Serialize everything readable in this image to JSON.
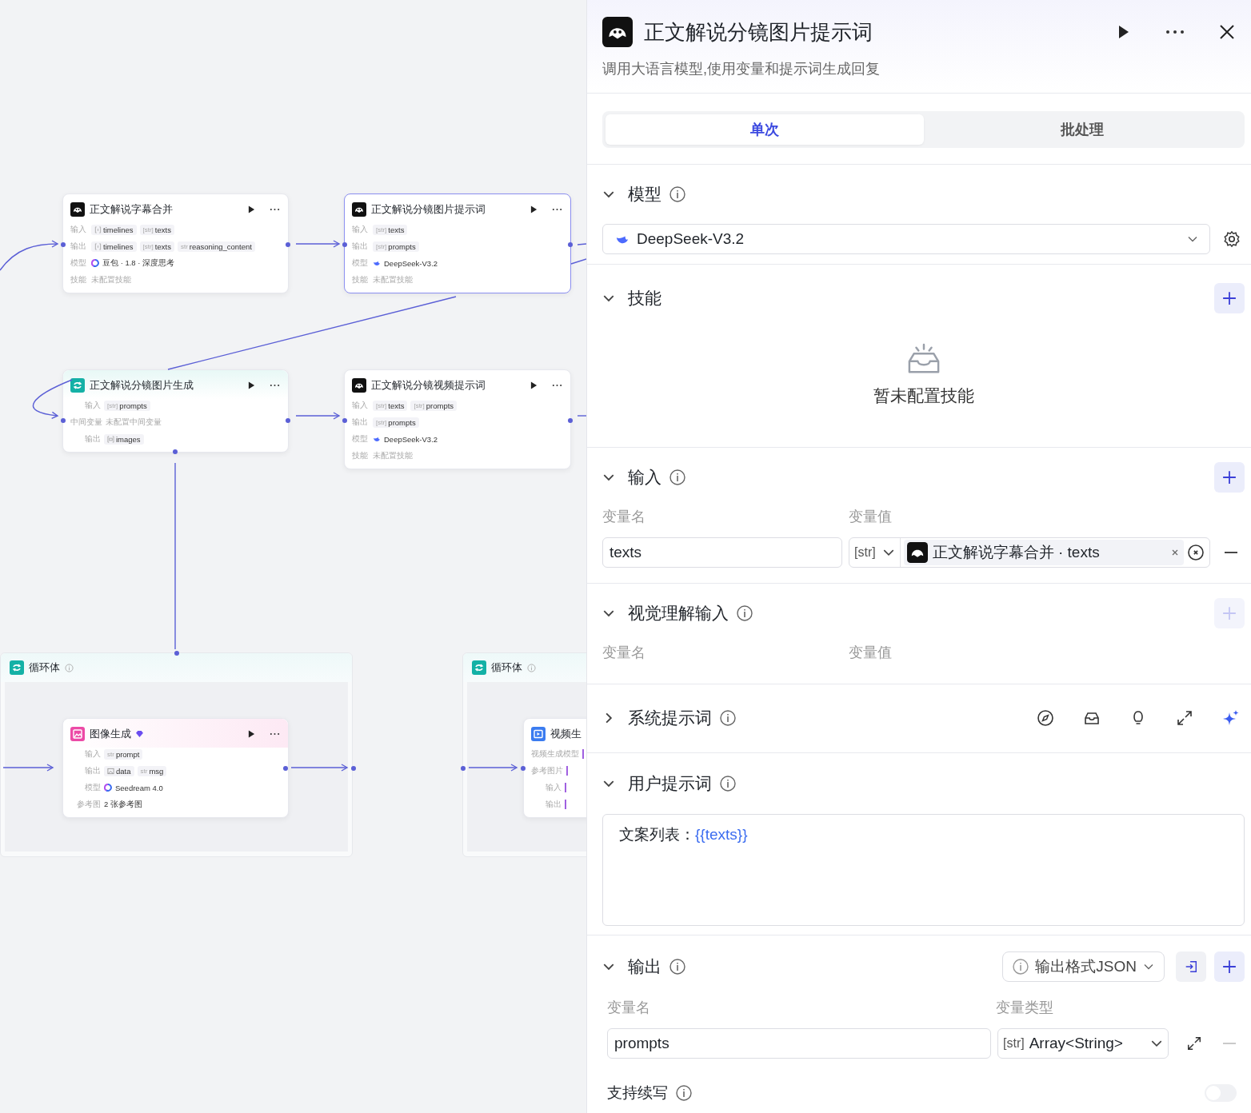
{
  "canvas": {
    "nodes": [
      {
        "kind": "llm",
        "title": "正文解说字幕合并",
        "selected": false,
        "rows": [
          {
            "label": "输入",
            "kind": "vars",
            "vars": [
              {
                "kind": "object_array",
                "name": "timelines"
              },
              {
                "kind": "tagged",
                "tag": "[str]",
                "name": "texts"
              }
            ]
          },
          {
            "label": "输出",
            "kind": "vars",
            "vars": [
              {
                "kind": "object_array",
                "name": "timelines"
              },
              {
                "kind": "tagged",
                "tag": "[str]",
                "name": "texts"
              },
              {
                "kind": "tagged",
                "tag": "str",
                "name": "reasoning_content"
              }
            ]
          },
          {
            "label": "模型",
            "kind": "model",
            "text": "豆包 · 1.8 · 深度思考"
          },
          {
            "label": "技能",
            "kind": "empty",
            "text": "未配置技能"
          }
        ]
      },
      {
        "kind": "llm",
        "title": "正文解说分镜图片提示词",
        "selected": true,
        "rows": [
          {
            "label": "输入",
            "kind": "vars",
            "vars": [
              {
                "kind": "tagged",
                "tag": "[str]",
                "name": "texts"
              }
            ]
          },
          {
            "label": "输出",
            "kind": "vars",
            "vars": [
              {
                "kind": "tagged",
                "tag": "[str]",
                "name": "prompts"
              }
            ]
          },
          {
            "label": "模型",
            "kind": "model",
            "text": "DeepSeek-V3.2"
          },
          {
            "label": "技能",
            "kind": "empty",
            "text": "未配置技能"
          }
        ]
      },
      {
        "kind": "loop",
        "title": "正文解说分镜图片生成",
        "selected": false,
        "rows": [
          {
            "label": "输入",
            "kind": "vars",
            "vars": [
              {
                "kind": "tagged",
                "tag": "[str]",
                "name": "prompts"
              }
            ]
          },
          {
            "label": "中间变量",
            "kind": "empty",
            "text": "未配置中间变量"
          },
          {
            "label": "输出",
            "kind": "vars",
            "vars": [
              {
                "kind": "image_array",
                "name": "images"
              }
            ]
          }
        ]
      },
      {
        "kind": "llm",
        "title": "正文解说分镜视频提示词",
        "selected": false,
        "rows": [
          {
            "label": "输入",
            "kind": "vars",
            "vars": [
              {
                "kind": "tagged",
                "tag": "[str]",
                "name": "texts"
              },
              {
                "kind": "tagged",
                "tag": "[str]",
                "name": "prompts"
              }
            ]
          },
          {
            "label": "输出",
            "kind": "vars",
            "vars": [
              {
                "kind": "tagged",
                "tag": "[str]",
                "name": "prompts"
              }
            ]
          },
          {
            "label": "模型",
            "kind": "model",
            "text": "DeepSeek-V3.2"
          },
          {
            "label": "技能",
            "kind": "empty",
            "text": "未配置技能"
          }
        ]
      }
    ],
    "loops": [
      {
        "title": "循环体",
        "inner": {
          "kind": "image",
          "title": "图像生成",
          "premium": true,
          "selected": false,
          "rows": [
            {
              "label": "输入",
              "kind": "vars",
              "vars": [
                {
                  "kind": "tagged",
                  "tag": "str",
                  "name": "prompt"
                }
              ]
            },
            {
              "label": "输出",
              "kind": "vars",
              "vars": [
                {
                  "kind": "image",
                  "name": "data"
                },
                {
                  "kind": "tagged",
                  "tag": "str",
                  "name": "msg"
                }
              ]
            },
            {
              "label": "模型",
              "kind": "model",
              "text": "Seedream 4.0"
            },
            {
              "label": "参考图",
              "kind": "text",
              "text": "2 张参考图"
            }
          ]
        }
      },
      {
        "title": "循环体",
        "inner": {
          "kind": "video",
          "title": "视频生",
          "premium": false,
          "selected": false,
          "rows": [
            {
              "label": "视频生成模型",
              "kind": "label"
            },
            {
              "label": "参考图片",
              "kind": "label"
            },
            {
              "label": "输入",
              "kind": "label"
            },
            {
              "label": "输出",
              "kind": "label"
            }
          ]
        }
      }
    ]
  },
  "panel": {
    "title": "正文解说分镜图片提示词",
    "description": "调用大语言模型,使用变量和提示词生成回复",
    "tabs": [
      {
        "label": "单次",
        "selected": true
      },
      {
        "label": "批处理",
        "selected": false
      }
    ],
    "model": {
      "title": "模型",
      "info": true,
      "expanded": true,
      "value": "DeepSeek-V3.2"
    },
    "skills": {
      "title": "技能",
      "info": false,
      "expanded": true,
      "add_disabled": false,
      "empty_text": "暂未配置技能"
    },
    "input": {
      "title": "输入",
      "info": true,
      "expanded": true,
      "add_disabled": false,
      "columns": [
        "变量名",
        "变量值"
      ],
      "rows": [
        {
          "name": "texts",
          "type": "[str]",
          "source": "正文解说字幕合并 · texts"
        }
      ]
    },
    "vision_input": {
      "title": "视觉理解输入",
      "info": true,
      "expanded": true,
      "add_disabled": true,
      "columns": [
        "变量名",
        "变量值"
      ]
    },
    "system_prompt": {
      "title": "系统提示词",
      "info": true,
      "expanded": false
    },
    "user_prompt": {
      "title": "用户提示词",
      "info": true,
      "expanded": true,
      "text": "文案列表：",
      "variable": "{{texts}}"
    },
    "output": {
      "title": "输出",
      "info": true,
      "expanded": true,
      "add_disabled": false,
      "format": "输出格式JSON",
      "columns": [
        "变量名",
        "变量类型"
      ],
      "rows": [
        {
          "name": "prompts",
          "type_tag": "[str]",
          "type": "Array<String>"
        }
      ]
    },
    "continue": {
      "label": "支持续写",
      "info": true,
      "on": false
    }
  }
}
